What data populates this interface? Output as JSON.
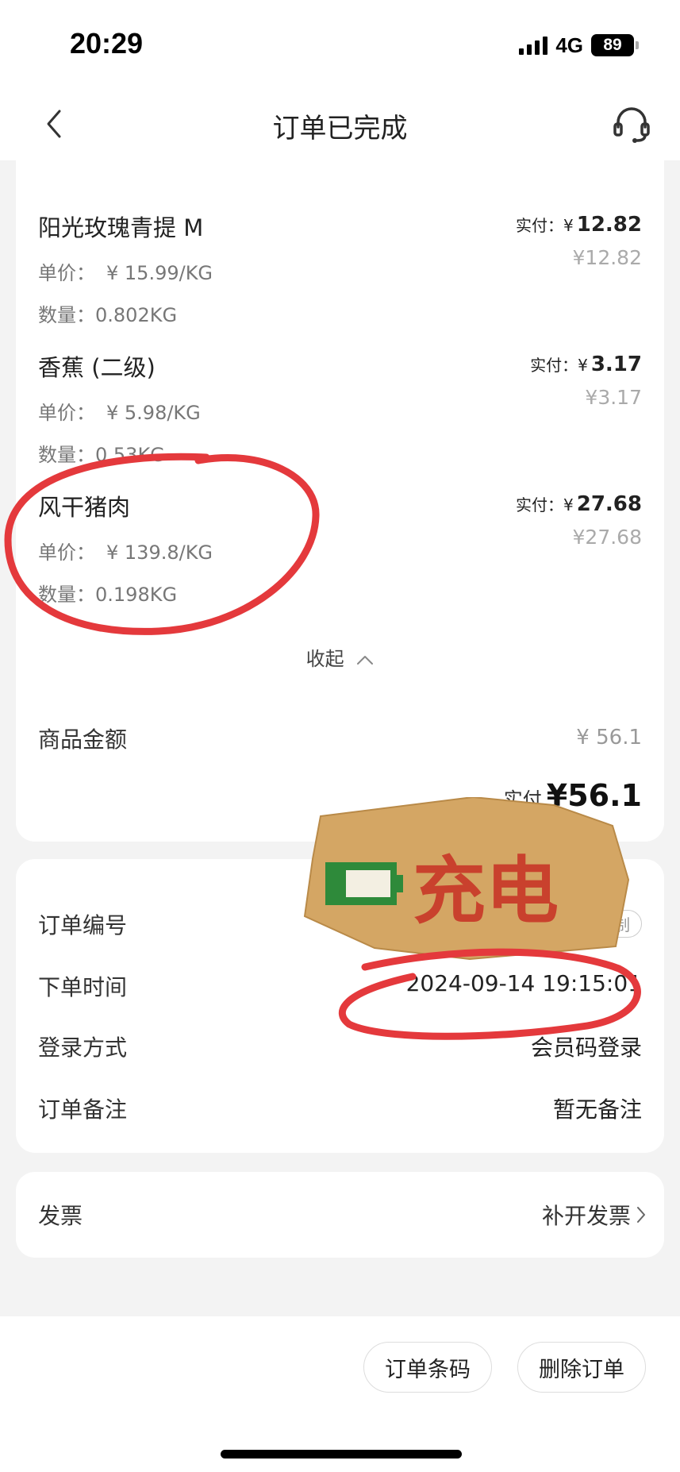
{
  "status_bar": {
    "time": "20:29",
    "network": "4G",
    "battery": "89"
  },
  "nav": {
    "title": "订单已完成",
    "back_icon": "chevron-left-icon",
    "support_icon": "headset-icon"
  },
  "items": [
    {
      "name": "阳光玫瑰青提 M",
      "unit_price_label": "单价：",
      "unit_price": "¥ 15.99/KG",
      "quantity_label": "数量：",
      "quantity": "0.802KG",
      "paid_label": "实付：¥",
      "paid": "12.82",
      "original": "¥12.82"
    },
    {
      "name": "香蕉 (二级)",
      "unit_price_label": "单价：",
      "unit_price": "¥ 5.98/KG",
      "quantity_label": "数量：",
      "quantity": "0.53KG",
      "paid_label": "实付：¥",
      "paid": "3.17",
      "original": "¥3.17"
    },
    {
      "name": "风干猪肉",
      "unit_price_label": "单价：",
      "unit_price": "¥ 139.8/KG",
      "quantity_label": "数量：",
      "quantity": "0.198KG",
      "paid_label": "实付：¥",
      "paid": "27.68",
      "original": "¥27.68"
    }
  ],
  "collapse_label": "收起",
  "summary": {
    "subtotal_label": "商品金额",
    "subtotal_value": "¥ 56.1",
    "paid_label": "实付",
    "paid_value": "¥56.1"
  },
  "order_info": {
    "order_no_label": "订单编号",
    "copy_label": "复制",
    "time_label": "下单时间",
    "time_value": "2024-09-14 19:15:01",
    "login_label": "登录方式",
    "login_value": "会员码登录",
    "note_label": "订单备注",
    "note_value": "暂无备注"
  },
  "invoice": {
    "label": "发票",
    "action": "补开发票"
  },
  "bottom": {
    "barcode_button": "订单条码",
    "delete_button": "删除订单"
  },
  "sticker": {
    "text": "充电"
  },
  "colors": {
    "annotation_red": "#e4393c",
    "sticker_bg": "#d4a664",
    "sticker_text": "#c9412d",
    "battery_green": "#2e8a3a"
  }
}
